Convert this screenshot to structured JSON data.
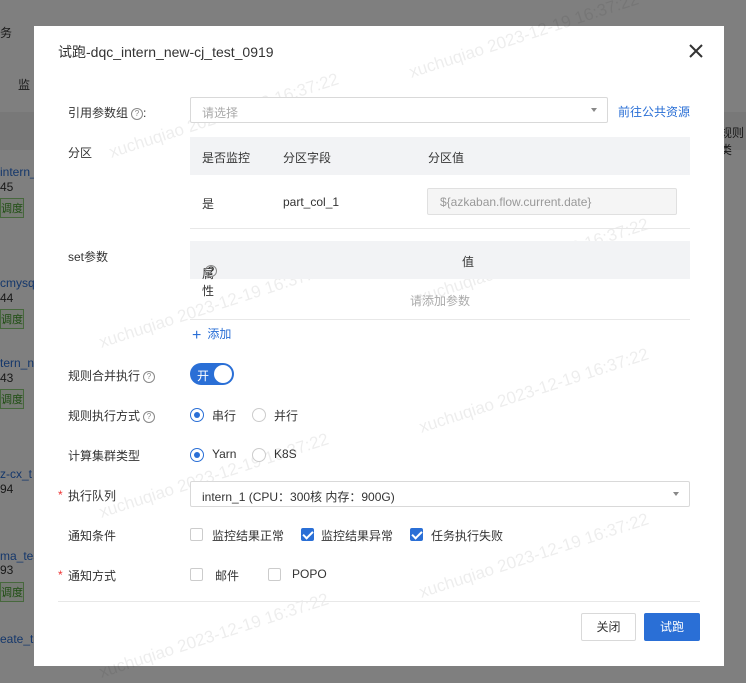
{
  "background": {
    "tab_fragment": "务",
    "monitor_fragment": "监",
    "rule_fragment": "规则类",
    "rows": [
      {
        "name": "intern_ne",
        "num": "45",
        "tag": "调度"
      },
      {
        "name": "cmysq",
        "num": "44",
        "tag": "调度"
      },
      {
        "name": "tern_ne",
        "num": "43",
        "tag": "调度"
      },
      {
        "name": "z-cx_t",
        "num": "94",
        "tag": ""
      },
      {
        "name": "ma_tes",
        "num": "93",
        "tag": "调度"
      },
      {
        "name": "eate_ta",
        "num": "",
        "tag": ""
      }
    ]
  },
  "dialog": {
    "title": "试跑-dqc_intern_new-cj_test_0919",
    "param_group": {
      "label": "引用参数组",
      "colon": ":",
      "placeholder": "请选择",
      "link": "前往公共资源"
    },
    "partition": {
      "label": "分区",
      "headers": [
        "是否监控",
        "分区字段",
        "分区值"
      ],
      "row": {
        "monitor": "是",
        "field": "part_col_1",
        "value": "${azkaban.flow.current.date}"
      }
    },
    "set_params": {
      "label": "set参数",
      "headers": [
        "属性",
        "值"
      ],
      "empty_text": "请添加参数",
      "add_label": "添加"
    },
    "merge_exec": {
      "label": "规则合并执行",
      "toggle_text": "开",
      "enabled": true
    },
    "exec_mode": {
      "label": "规则执行方式",
      "options": [
        "串行",
        "并行"
      ],
      "selected": "串行"
    },
    "cluster_type": {
      "label": "计算集群类型",
      "options": [
        "Yarn",
        "K8S"
      ],
      "selected": "Yarn"
    },
    "queue": {
      "label": "执行队列",
      "value": "intern_1 (CPU：300核 内存：900G)"
    },
    "notify_condition": {
      "label": "通知条件",
      "options": [
        {
          "label": "监控结果正常",
          "checked": false
        },
        {
          "label": "监控结果异常",
          "checked": true
        },
        {
          "label": "任务执行失败",
          "checked": true
        }
      ]
    },
    "notify_method": {
      "label": "通知方式",
      "options": [
        {
          "label": "邮件",
          "checked": false
        },
        {
          "label": "POPO",
          "checked": false
        }
      ]
    },
    "buttons": {
      "cancel": "关闭",
      "ok": "试跑"
    },
    "watermark": "xuchuqiao 2023-12-19 16:37:22"
  },
  "colors": {
    "accent": "#2a6fd6",
    "required": "#e33333"
  }
}
